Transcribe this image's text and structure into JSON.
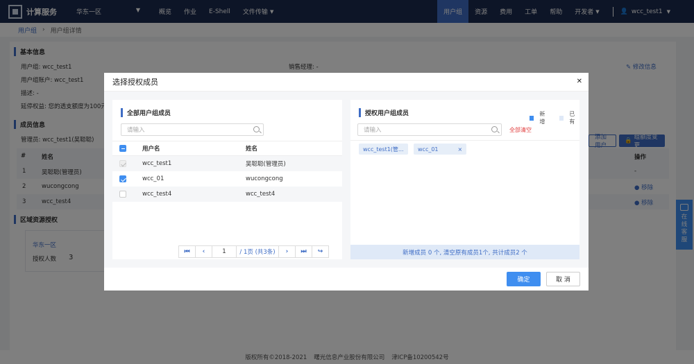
{
  "app": {
    "logo_text": "计算服务",
    "region": "华东一区"
  },
  "nav": {
    "left": [
      "概览",
      "作业",
      "E-Shell",
      "文件传输"
    ],
    "right": [
      "用户组",
      "资源",
      "费用",
      "工单",
      "帮助",
      "开发者"
    ],
    "active": "用户组",
    "user": "wcc_test1"
  },
  "breadcrumb": {
    "root": "用户组",
    "current": "用户组详情"
  },
  "basic": {
    "title": "基本信息",
    "group_label": "用户组: wcc_test1",
    "account_label": "用户组账户: wcc_test1",
    "desc_label": "描述: -",
    "suspend_label": "延停权益: 您的透支额度为100元",
    "sales_label": "销售经理: -",
    "edit_link": "修改信息"
  },
  "members": {
    "title": "成员信息",
    "admin_label": "管理员: wcc_test1(吴聪聪)",
    "add_button": "添加用户",
    "quota_button": "组额度变更",
    "col_index": "#",
    "col_name": "姓名",
    "col_op": "操作",
    "rows": [
      {
        "index": "1",
        "name": "吴聪聪(管理员)",
        "op": "-"
      },
      {
        "index": "2",
        "name": "wucongcong",
        "op": "移除"
      },
      {
        "index": "3",
        "name": "wcc_test4",
        "op": "移除"
      }
    ]
  },
  "region_auth": {
    "title": "区域资源授权",
    "region": "华东一区",
    "count_label": "授权人数",
    "count": "3"
  },
  "modal": {
    "title": "选择授权成员",
    "left": {
      "title": "全部用户组成员",
      "search_placeholder": "请输入",
      "col_user": "用户名",
      "col_name": "姓名",
      "rows": [
        {
          "user": "wcc_test1",
          "name": "吴聪聪(管理员)",
          "state": "disabled"
        },
        {
          "user": "wcc_01",
          "name": "wucongcong",
          "state": "checked"
        },
        {
          "user": "wcc_test4",
          "name": "wcc_test4",
          "state": "unchecked"
        }
      ],
      "pager": {
        "page": "1",
        "total_text": "/ 1页 (共3条)"
      }
    },
    "right": {
      "title": "授权用户组成员",
      "legend_new": "新增",
      "legend_existing": "已有",
      "search_placeholder": "请输入",
      "clear_all": "全部清空",
      "tags": [
        {
          "label": "wcc_test1(管...",
          "removable": false
        },
        {
          "label": "wcc_01",
          "removable": true
        }
      ],
      "summary": "新增成员 0 个, 清空原有成员1个, 共计成员2 个"
    },
    "ok": "确定",
    "cancel": "取 消"
  },
  "online_service": {
    "label_1": "在",
    "label_2": "线",
    "label_3": "客",
    "label_4": "服"
  },
  "footer": {
    "copyright": "版权所有©2018-2021",
    "company": "曙光信息产业股份有限公司",
    "icp": "津ICP备10200542号"
  },
  "colors": {
    "nav_bg": "#1b2a4e",
    "accent": "#3f6dc5",
    "primary_button": "#3f8ef0"
  }
}
